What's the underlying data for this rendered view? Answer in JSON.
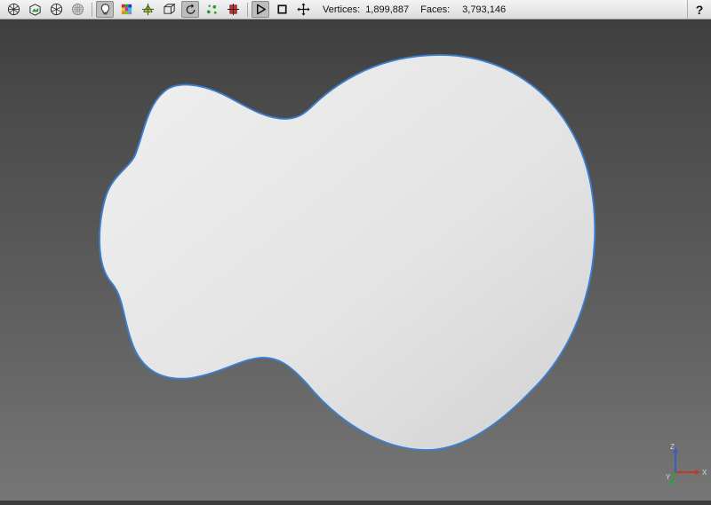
{
  "toolbar": {
    "buttons": [
      {
        "id": "wireframe-sphere-icon",
        "active": false
      },
      {
        "id": "shaded-box-icon",
        "active": false
      },
      {
        "id": "vertex-sphere-icon",
        "active": false
      },
      {
        "id": "point-grid-icon",
        "active": false
      },
      {
        "id": "light-bulb-icon",
        "active": true
      },
      {
        "id": "color-grid-icon",
        "active": false
      },
      {
        "id": "move-model-icon",
        "active": false
      },
      {
        "id": "cube-icon",
        "active": false
      },
      {
        "id": "rotate-icon",
        "active": true
      },
      {
        "id": "points-icon",
        "active": false
      },
      {
        "id": "clip-plane-icon",
        "active": false
      },
      {
        "id": "play-icon",
        "active": true
      },
      {
        "id": "stop-icon",
        "active": false
      },
      {
        "id": "pan-arrows-icon",
        "active": false
      }
    ],
    "stats": {
      "vertices_label": "Vertices:",
      "vertices_value": "1,899,887",
      "faces_label": "Faces:",
      "faces_value": "3,793,146"
    },
    "help_label": "?"
  },
  "viewport": {
    "model_color": "#e6e6e6",
    "outline_color": "#3a7fd0"
  },
  "triad": {
    "x_label": "X",
    "y_label": "Y",
    "z_label": "Z",
    "x_color": "#c0392b",
    "y_color": "#2e9e3a",
    "z_color": "#3b5bc9"
  }
}
